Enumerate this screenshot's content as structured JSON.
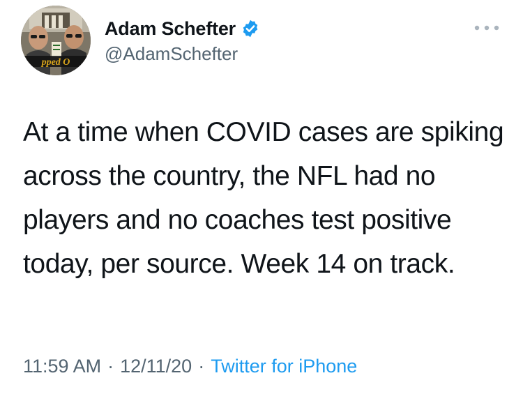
{
  "author": {
    "display_name": "Adam Schefter",
    "handle": "@AdamSchefter",
    "verified": true,
    "avatar_banner_text": "pped O"
  },
  "tweet": {
    "text": "At a time when COVID cases are spiking across the country, the NFL had no players and no coaches test positive today, per source. Week 14 on track.",
    "time": "11:59 AM",
    "date": "12/11/20",
    "separator": "·",
    "source": "Twitter for iPhone"
  },
  "colors": {
    "verified_badge": "#1d9bf0",
    "link": "#1d9bf0",
    "secondary_text": "#536471"
  },
  "icons": {
    "more": "more-horizontal-icon",
    "verified": "verified-badge-icon"
  }
}
